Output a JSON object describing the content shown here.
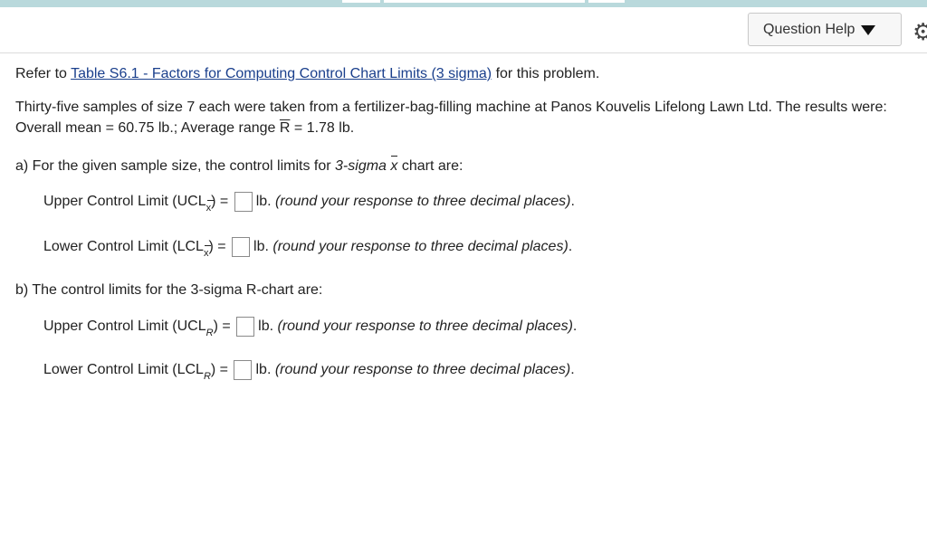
{
  "header": {
    "help_label": "Question Help"
  },
  "refer": {
    "prefix": "Refer to ",
    "link": "Table S6.1 - Factors for Computing Control Chart Limits (3 sigma)",
    "suffix": " for this problem."
  },
  "problem": {
    "line1": "Thirty-five samples of size 7 each were taken from a fertilizer-bag-filling machine at Panos Kouvelis Lifelong Lawn Ltd. The results were:",
    "line2_a": "Overall mean = 60.75 lb.; Average range ",
    "line2_r": "R",
    "line2_b": " = 1.78 lb."
  },
  "part_a": {
    "intro_a": "a) For the given sample size, the control limits for ",
    "intro_sigma": "3-sigma ",
    "intro_x": "x",
    "intro_b": " chart are:",
    "ucl_label": "Upper Control Limit (UCL",
    "ucl_sub": "x",
    "ucl_close": ") =",
    "lcl_label": "Lower Control Limit (LCL",
    "lcl_sub": "x",
    "lcl_close": ") ="
  },
  "part_b": {
    "intro": "b) The control limits for the 3-sigma R-chart are:",
    "ucl_label": "Upper Control Limit (UCL",
    "ucl_sub": "R",
    "ucl_close": ") =",
    "lcl_label": "Lower Control Limit (LCL",
    "lcl_sub": "R",
    "lcl_close": ") ="
  },
  "units": "lb.",
  "hint": "(round your response to three decimal places)",
  "period": ".",
  "icons": {
    "dropdown": "triangle-down",
    "settings": "gear"
  }
}
